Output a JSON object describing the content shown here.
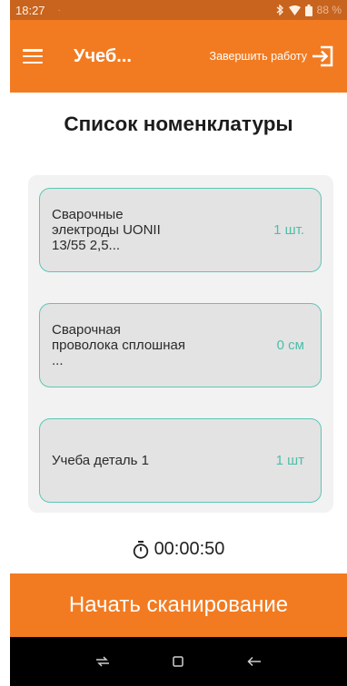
{
  "status_bar": {
    "time": "18:27",
    "battery": "88 %"
  },
  "app_bar": {
    "title": "Учеб...",
    "finish_label": "Завершить работу"
  },
  "page": {
    "title": "Список номенклатуры"
  },
  "items": [
    {
      "name": "Сварочные электроды UONII 13/55 2,5...",
      "qty": "1 шт."
    },
    {
      "name": "Сварочная проволока сплошная ...",
      "qty": "0 см"
    },
    {
      "name": "Учеба деталь 1",
      "qty": "1 шт"
    }
  ],
  "timer": {
    "value": "00:00:50"
  },
  "scan_button": {
    "label": "Начать сканирование"
  },
  "colors": {
    "accent": "#f27b21",
    "status_bar": "#c8641d",
    "card_border": "#5cc7b4",
    "qty_text": "#4cbfa9"
  }
}
